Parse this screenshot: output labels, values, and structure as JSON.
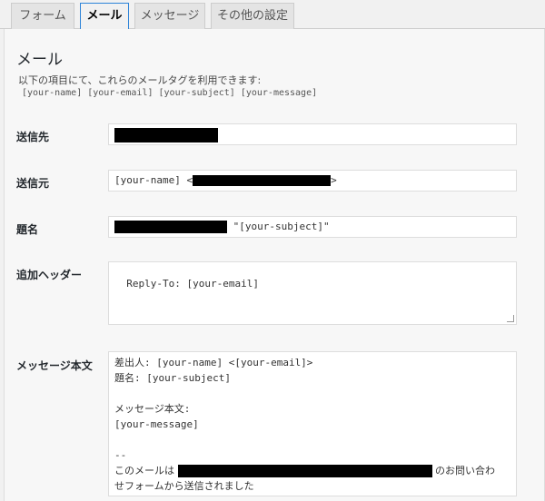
{
  "tabs": [
    {
      "label": "フォーム"
    },
    {
      "label": "メール"
    },
    {
      "label": "メッセージ"
    },
    {
      "label": "その他の設定"
    }
  ],
  "section": {
    "title": "メール",
    "description": "以下の項目にて、これらのメールタグを利用できます:",
    "tags": "[your-name] [your-email] [your-subject] [your-message]"
  },
  "fields": {
    "to": {
      "label": "送信先"
    },
    "from": {
      "label": "送信元",
      "prefix": "[your-name] <",
      "suffix": ">"
    },
    "subject": {
      "label": "題名",
      "suffix": "\"[your-subject]\""
    },
    "headers": {
      "label": "追加ヘッダー",
      "value": "Reply-To: [your-email]"
    },
    "body": {
      "label": "メッセージ本文",
      "line1": "差出人: [your-name] <[your-email]>",
      "line2": "題名: [your-subject]",
      "line3": "メッセージ本文:",
      "line4": "[your-message]",
      "line5": "--",
      "line6_prefix": "このメールは",
      "line6_suffix": "のお問い合わ",
      "line7": "せフォームから送信されました"
    }
  }
}
